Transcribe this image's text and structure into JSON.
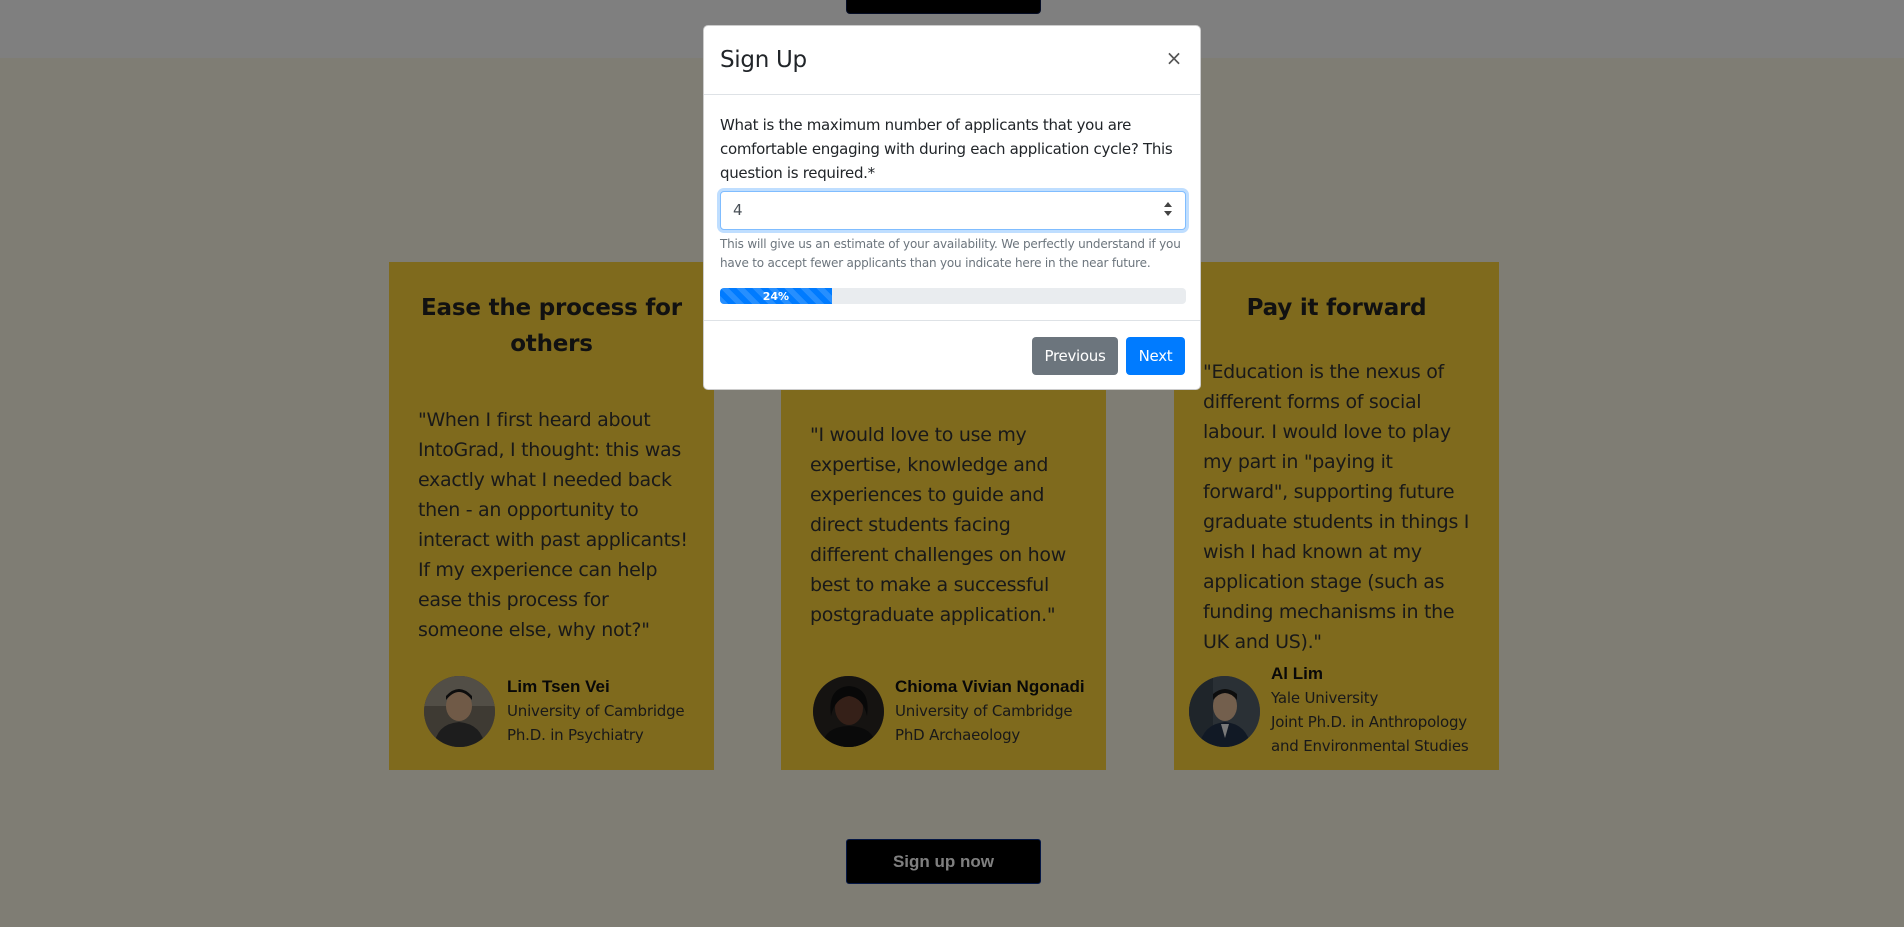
{
  "background": {
    "cards": [
      {
        "title": "Ease the process for others",
        "quote": "\"When I first heard about IntoGrad, I thought: this was exactly what I needed back then - an opportunity to interact with past applicants! If my experience can help ease this process for someone else, why not?\"",
        "person": {
          "name": "Lim Tsen Vei",
          "line1": "University of Cambridge",
          "line2": "Ph.D. in Psychiatry",
          "line3": ""
        }
      },
      {
        "title": "",
        "quote": "\"I would love to use my expertise, knowledge and experiences to guide and direct students facing different challenges on how best to make a successful postgraduate application.\"",
        "person": {
          "name": "Chioma Vivian Ngonadi",
          "line1": "University of Cambridge",
          "line2": "PhD Archaeology",
          "line3": ""
        }
      },
      {
        "title": "Pay it forward",
        "quote": "\"Education is the nexus of different forms of social labour. I would love to play my part in \"paying it forward\", supporting future graduate students in things I wish I had known at my application stage (such as funding mechanisms in the UK and US).\"",
        "person": {
          "name": "Al Lim",
          "line1": "Yale University",
          "line2": "Joint Ph.D. in Anthropology",
          "line3": "and Environmental Studies"
        }
      }
    ],
    "signup_button": "Sign up now"
  },
  "modal": {
    "title": "Sign Up",
    "close_label": "×",
    "question": "What is the maximum number of applicants that you are comfortable engaging with during each application cycle? This question is required.*",
    "input_value": "4",
    "help_text": "This will give us an estimate of your availability. We perfectly understand if you have to accept fewer applicants than you indicate here in the near future.",
    "progress_percent": 24,
    "progress_label": "24%",
    "previous_label": "Previous",
    "next_label": "Next"
  },
  "colors": {
    "card": "#ffd43b",
    "primary": "#007bff",
    "secondary": "#6c757d"
  }
}
